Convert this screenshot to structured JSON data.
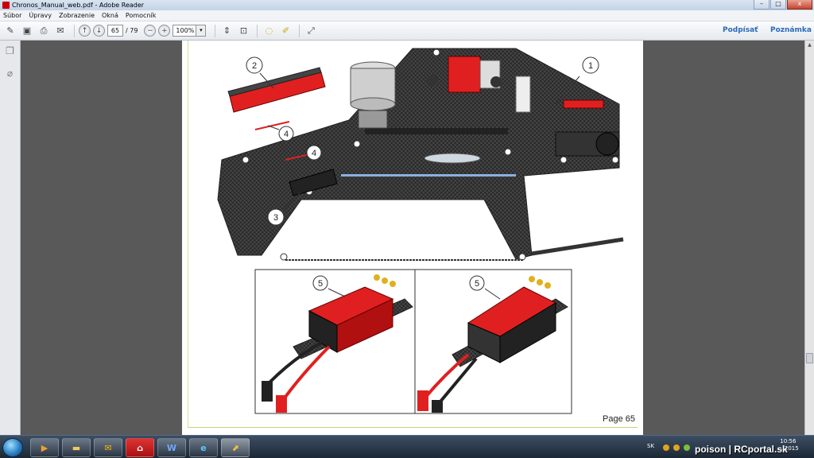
{
  "window": {
    "title": "Chronos_Manual_web.pdf - Adobe Reader",
    "min": "–",
    "max": "□",
    "close": "x"
  },
  "menu": [
    "Súbor",
    "Úpravy",
    "Zobrazenie",
    "Okná",
    "Pomocník"
  ],
  "toolbar": {
    "page_current": "65",
    "page_total": "/ 79",
    "zoom": "100%",
    "zoom_drop": "▾",
    "sign_label": "Podpísať",
    "comment_label": "Poznámka"
  },
  "document": {
    "page_label": "Page 65",
    "callouts": [
      "1",
      "2",
      "3",
      "4",
      "4",
      "5",
      "5"
    ]
  },
  "taskbar": {
    "apps": [
      "media-player",
      "explorer",
      "outlook",
      "adobe-reader",
      "word",
      "internet-explorer",
      "pdf-viewer"
    ],
    "word_glyph": "W",
    "ie_glyph": "e",
    "lang": "SK",
    "time": "10:56",
    "date": "... 2015",
    "watermark": "poison | RCportal.sk"
  },
  "colors": {
    "accent": "#2a6ab8",
    "esc_red": "#e02020",
    "frame": "#3a3a3a"
  }
}
